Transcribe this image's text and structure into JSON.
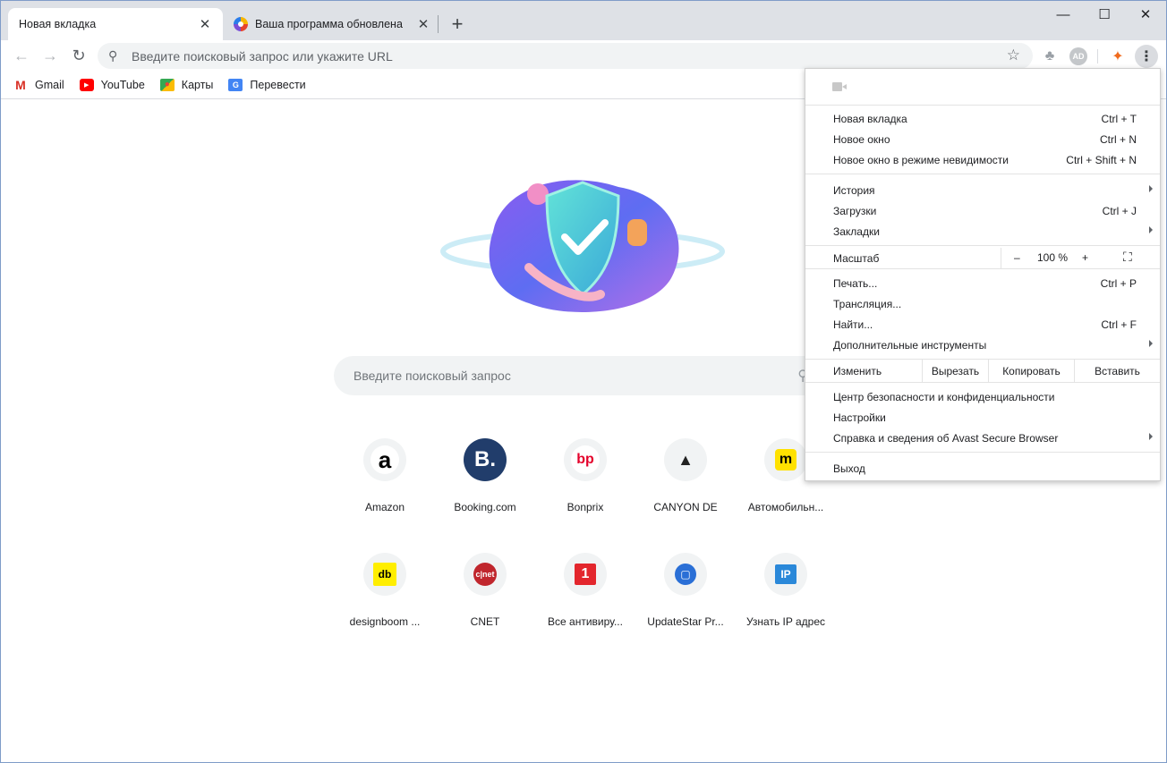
{
  "window": {
    "minimize": "—",
    "maximize": "☐",
    "close": "✕"
  },
  "tabs": [
    {
      "label": "Новая вкладка",
      "active": true
    },
    {
      "label": "Ваша программа обновлена",
      "active": false
    }
  ],
  "tabs_close": "✕",
  "new_tab": "+",
  "toolbar": {
    "back": "←",
    "forward": "→",
    "reload": "↻",
    "omnibox_placeholder": "Введите поисковый запрос или укажите URL",
    "star": "☆",
    "ext_ad": "AD",
    "menu": "⋮"
  },
  "bookmarks": [
    {
      "label": "Gmail",
      "icon": "gmail-icon"
    },
    {
      "label": "YouTube",
      "icon": "youtube-icon"
    },
    {
      "label": "Карты",
      "icon": "maps-icon"
    },
    {
      "label": "Перевести",
      "icon": "translate-icon"
    }
  ],
  "search": {
    "placeholder": "Введите поисковый запрос"
  },
  "tiles": [
    {
      "label": "Amazon",
      "glyph": "a",
      "color": "#000000",
      "bg": "#ffffff"
    },
    {
      "label": "Booking.com",
      "glyph": "B.",
      "color": "#ffffff",
      "bg": "#213d6b"
    },
    {
      "label": "Bonprix",
      "glyph": "bp",
      "color": "#e4002b",
      "bg": "#ffffff"
    },
    {
      "label": "CANYON DE",
      "glyph": "▲",
      "color": "#222222",
      "bg": "#f1f3f4"
    },
    {
      "label": "Автомобильн...",
      "glyph": "m",
      "color": "#000000",
      "bg": "#ffe100"
    },
    {
      "label": "designboom ...",
      "glyph": "db",
      "color": "#000000",
      "bg": "#ffee00"
    },
    {
      "label": "CNET",
      "glyph": "c|net",
      "color": "#ffffff",
      "bg": "#c0262d"
    },
    {
      "label": "Все антивиру...",
      "glyph": "1",
      "color": "#ffffff",
      "bg": "#e3262d"
    },
    {
      "label": "UpdateStar Pr...",
      "glyph": "▢",
      "color": "#ffffff",
      "bg": "#2a6fd6"
    },
    {
      "label": "Узнать IP адрес",
      "glyph": "IP",
      "color": "#ffffff",
      "bg": "#2a88d9"
    }
  ],
  "menu": {
    "new_tab": {
      "label": "Новая вкладка",
      "shortcut": "Ctrl + T"
    },
    "new_window": {
      "label": "Новое окно",
      "shortcut": "Ctrl + N"
    },
    "incognito": {
      "label": "Новое окно в режиме невидимости",
      "shortcut": "Ctrl + Shift + N"
    },
    "history": {
      "label": "История"
    },
    "downloads": {
      "label": "Загрузки",
      "shortcut": "Ctrl + J"
    },
    "bookmarks": {
      "label": "Закладки"
    },
    "zoom": {
      "label": "Масштаб",
      "minus": "–",
      "value": "100 %",
      "plus": "+"
    },
    "print": {
      "label": "Печать...",
      "shortcut": "Ctrl + P"
    },
    "cast": {
      "label": "Трансляция..."
    },
    "find": {
      "label": "Найти...",
      "shortcut": "Ctrl + F"
    },
    "more_tools": {
      "label": "Дополнительные инструменты"
    },
    "edit": {
      "label": "Изменить",
      "cut": "Вырезать",
      "copy": "Копировать",
      "paste": "Вставить"
    },
    "security": {
      "label": "Центр безопасности и конфиденциальности"
    },
    "settings": {
      "label": "Настройки"
    },
    "help": {
      "label": "Справка и сведения об Avast Secure Browser"
    },
    "exit": {
      "label": "Выход"
    }
  }
}
